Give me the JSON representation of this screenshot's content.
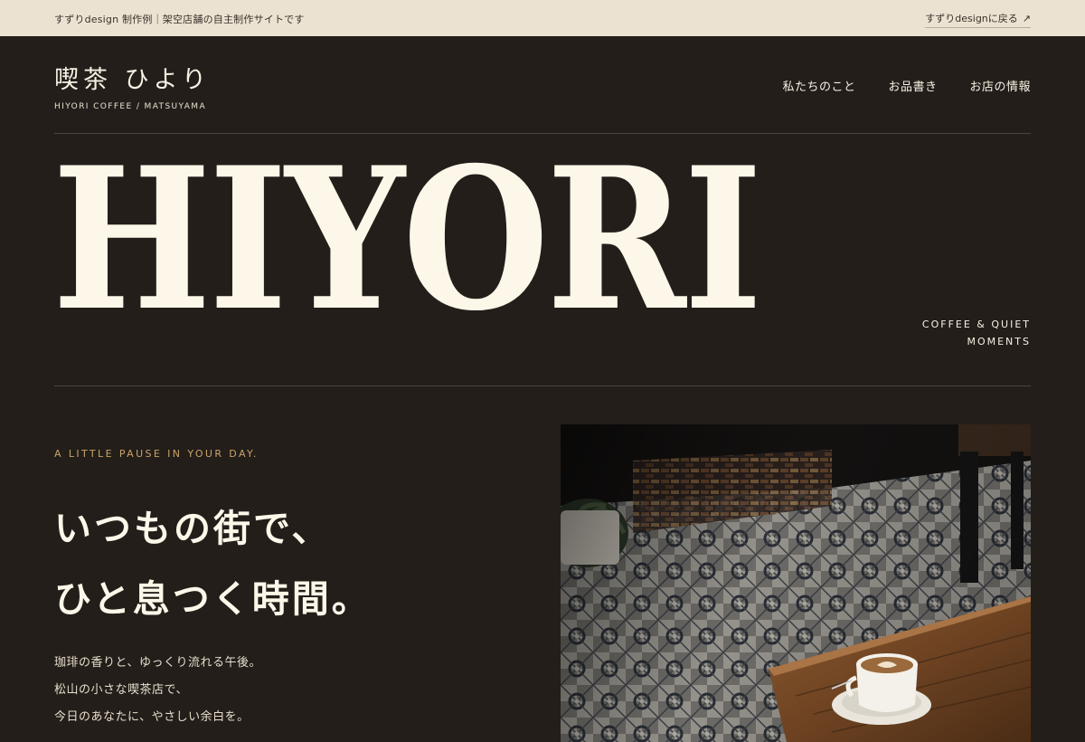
{
  "topbar": {
    "note": "すずりdesign 制作例｜架空店舗の自主制作サイトです",
    "back_link": "すずりdesignに戻る",
    "back_icon": "arrow-up-right-icon"
  },
  "header": {
    "brand_jp": "喫茶 ひより",
    "brand_en": "HIYORI COFFEE / MATSUYAMA",
    "nav": [
      "私たちのこと",
      "お品書き",
      "お店の情報"
    ]
  },
  "hero": {
    "wordmark": "HIYORI",
    "tagline_line1": "COFFEE & QUIET",
    "tagline_line2": "MOMENTS"
  },
  "intro": {
    "kicker": "A LITTLE PAUSE IN YOUR DAY.",
    "headline_line1": "いつもの街で、",
    "headline_line2": "ひと息つく時間。",
    "body": [
      "珈琲の香りと、ゆっくり流れる午後。",
      "松山の小さな喫茶店で、",
      "今日のあなたに、やさしい余白を。"
    ]
  },
  "colors": {
    "background": "#231e1a",
    "topbar": "#ebe2d1",
    "accent": "#c9a46a",
    "text": "#fdf7e9"
  }
}
